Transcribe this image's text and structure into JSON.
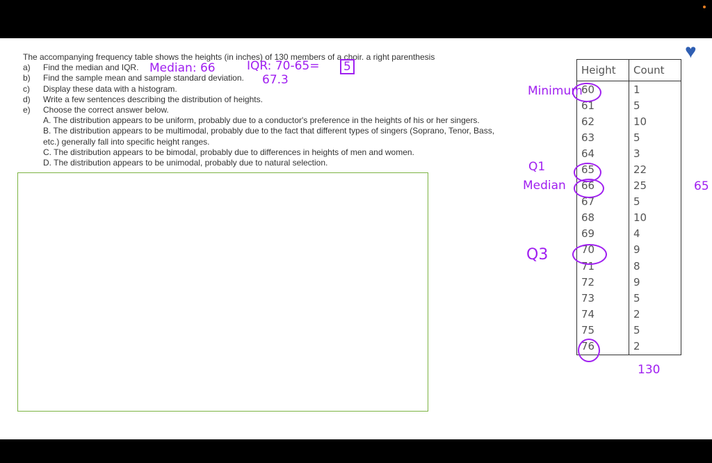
{
  "intro": "The accompanying frequency table shows the heights (in inches) of 130 members of a choir. a right parenthesis",
  "questions": [
    {
      "label": "a)",
      "text": "Find the median and IQR."
    },
    {
      "label": "b)",
      "text": "Find the sample mean and sample standard deviation."
    },
    {
      "label": "c)",
      "text": "Display these data with a histogram."
    },
    {
      "label": "d)",
      "text": "Write a few sentences describing the distribution of heights."
    },
    {
      "label": "e)",
      "text": "Choose the correct answer below."
    }
  ],
  "options": [
    "A. The distribution appears to be uniform, probably due to a conductor's preference in the heights of his or her singers.",
    "B. The distribution appears to be multimodal, probably due to the fact that different types of singers (Soprano, Tenor, Bass,",
    "etc.) generally fall into specific height ranges.",
    "C. The distribution appears to be bimodal, probably due to differences in heights of men and women.",
    "D. The distribution appears to be unimodal, probably due to natural selection."
  ],
  "table": {
    "headers": [
      "Height",
      "Count"
    ],
    "rows": [
      [
        "60",
        "1"
      ],
      [
        "61",
        "5"
      ],
      [
        "62",
        "10"
      ],
      [
        "63",
        "5"
      ],
      [
        "64",
        "3"
      ],
      [
        "65",
        "22"
      ],
      [
        "66",
        "25"
      ],
      [
        "67",
        "5"
      ],
      [
        "68",
        "10"
      ],
      [
        "69",
        "4"
      ],
      [
        "70",
        "9"
      ],
      [
        "71",
        "8"
      ],
      [
        "72",
        "9"
      ],
      [
        "73",
        "5"
      ],
      [
        "74",
        "2"
      ],
      [
        "75",
        "5"
      ],
      [
        "76",
        "2"
      ]
    ]
  },
  "annotations": {
    "median": "Median: 66",
    "iqr": "IQR: 70-65=",
    "iqr_value": "5",
    "mean": "67.3",
    "minimum": "Minimum",
    "q1": "Q1",
    "median_label": "Median",
    "q3": "Q3",
    "side": "65",
    "total": "130"
  },
  "colors": {
    "ink": "#a020f0",
    "heart": "#2f5fb3",
    "box_border": "#7cb342"
  }
}
